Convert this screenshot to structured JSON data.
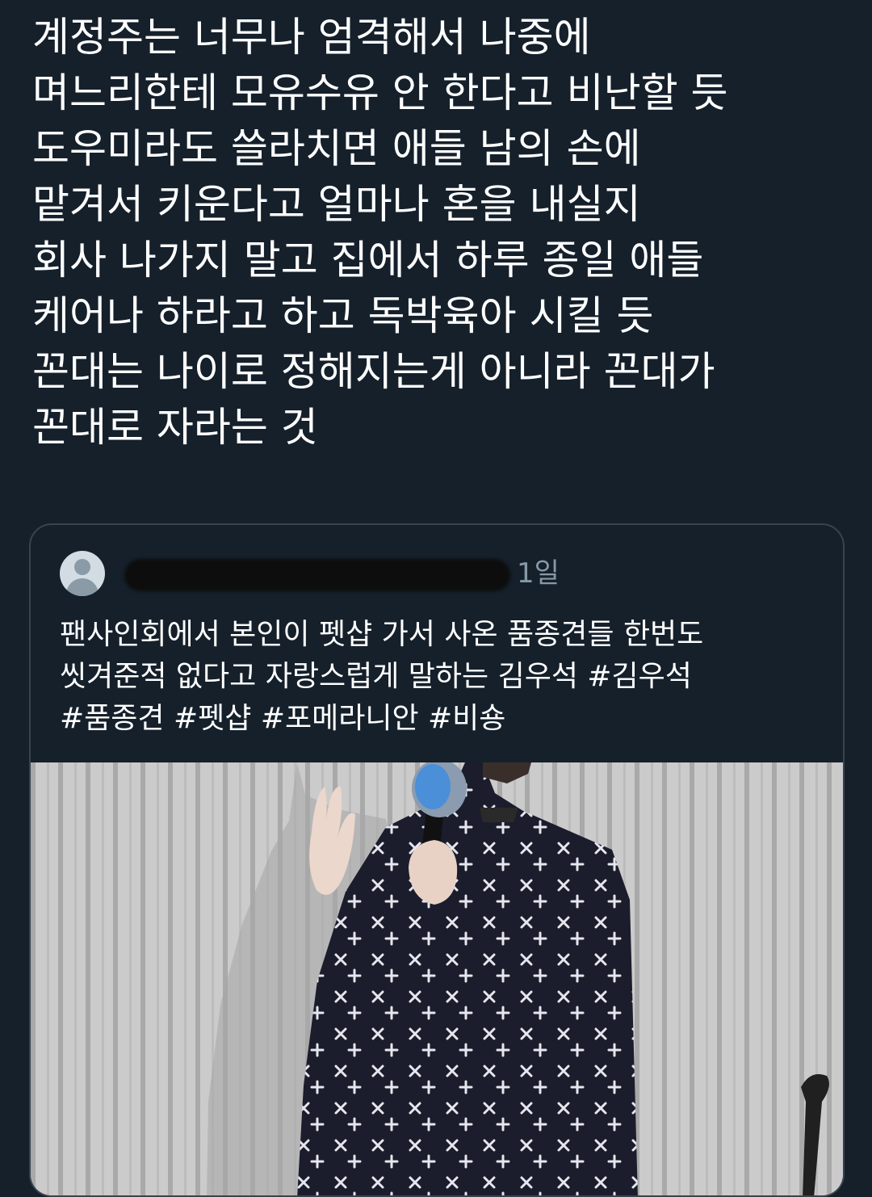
{
  "tweet": {
    "lines": [
      "계정주는 너무나 엄격해서 나중에",
      "며느리한테 모유수유 안 한다고 비난할 듯",
      "도우미라도 쓸라치면 애들 남의 손에",
      "맡겨서 키운다고 얼마나 혼을 내실지",
      "회사 나가지 말고 집에서 하루 종일 애들",
      "케어나 하라고 하고 독박육아 시킬 듯",
      "꼰대는 나이로 정해지는게 아니라 꼰대가",
      "꼰대로 자라는 것"
    ]
  },
  "quoted_tweet": {
    "timestamp": "1일",
    "lines": [
      "팬사인회에서 본인이 펫샵 가서 사온 품종견들 한번도",
      "씻겨준적 없다고 자랑스럽게 말하는 김우석 #김우석",
      "#품종견 #펫샵 #포메라니안 #비숑"
    ],
    "avatar_icon": "default-avatar-icon"
  },
  "colors": {
    "background": "#15202b",
    "text": "#ffffff",
    "secondary_text": "#8899a6",
    "card_border": "#38444d"
  }
}
